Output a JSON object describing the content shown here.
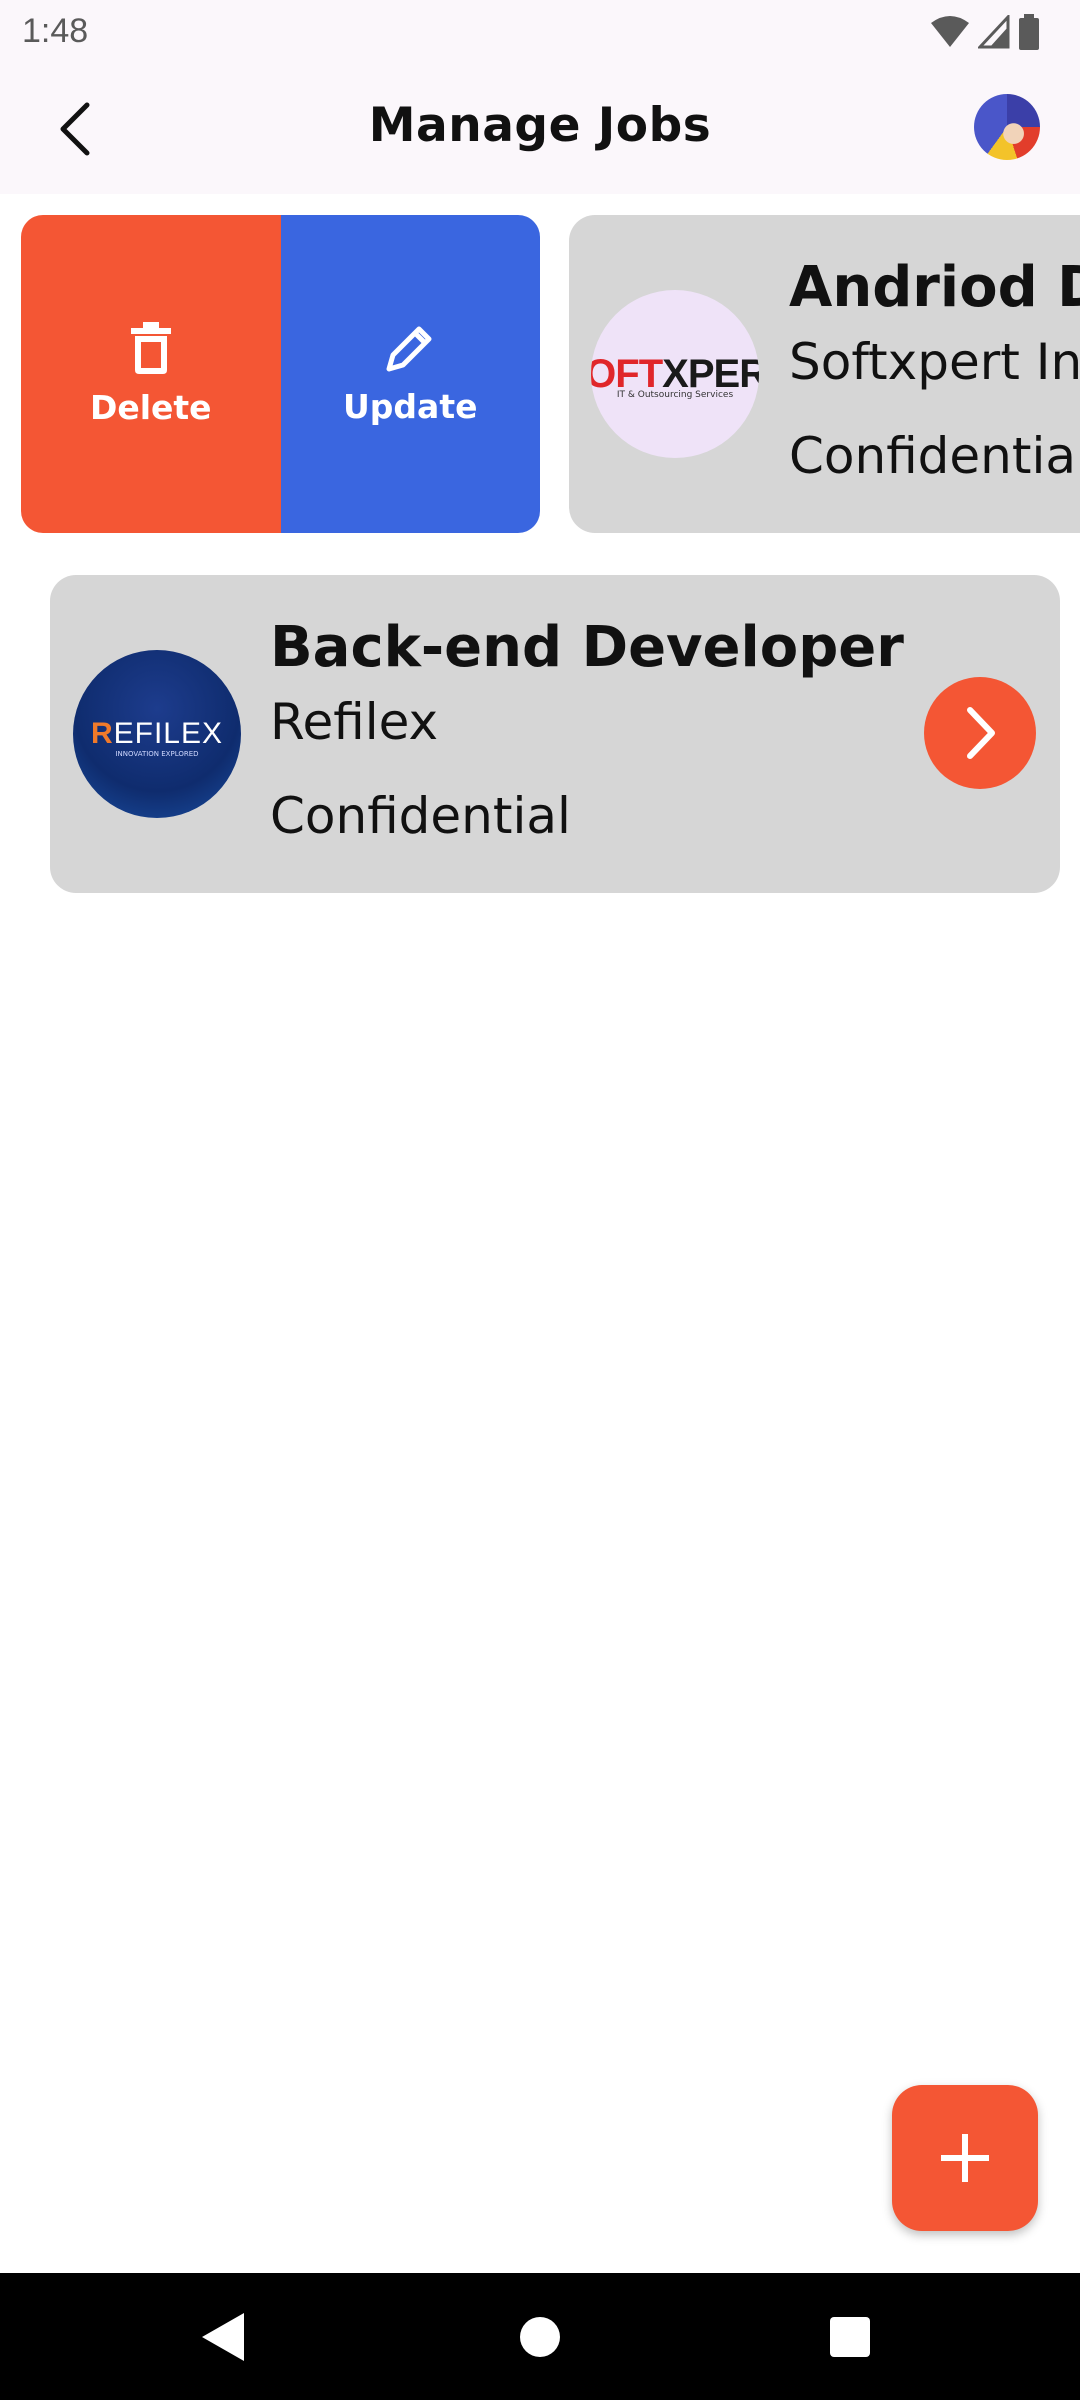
{
  "status": {
    "time": "1:48"
  },
  "header": {
    "title": "Manage Jobs"
  },
  "actions": {
    "delete_label": "Delete",
    "update_label": "Update"
  },
  "jobs": [
    {
      "title": "Andriod D",
      "company": "Softxpert In",
      "salary": "Confidentia",
      "logo": {
        "brand": "SOFTXPERT",
        "tagline": "IT & Outsourcing Services"
      }
    },
    {
      "title": "Back-end Developer",
      "company": "Refilex",
      "salary": "Confidential",
      "logo": {
        "brand": "REFILEX",
        "tagline": "INNOVATION EXPLORED"
      }
    }
  ],
  "colors": {
    "accent": "#f45634",
    "update": "#3a66e0",
    "card": "#d6d6d6"
  }
}
